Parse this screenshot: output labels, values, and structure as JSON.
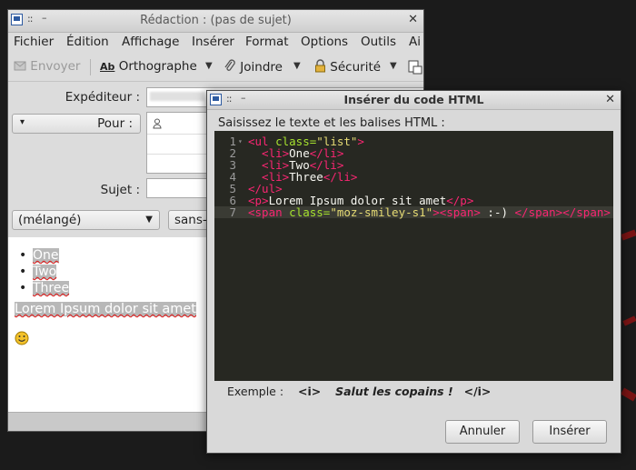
{
  "compose_window": {
    "title": "Rédaction : (pas de sujet)",
    "grip": "::",
    "minimize": "–",
    "close": "✕",
    "menu": [
      "Fichier",
      "Édition",
      "Affichage",
      "Insérer",
      "Format",
      "Options",
      "Outils",
      "Ai"
    ],
    "toolbar": {
      "send": "Envoyer",
      "spell_icon": "Ab",
      "spell": "Orthographe",
      "attach": "Joindre",
      "security": "Sécurité",
      "dropdown_arrow": "▼"
    },
    "headers": {
      "from_label": "Expéditeur :",
      "to_label": "Pour :",
      "to_dropdown_arrow": "▾",
      "subject_label": "Sujet :",
      "subject_value": ""
    },
    "format_bar": {
      "paragraph_style": "(mélangé)",
      "font": "sans-s",
      "arrow": "▼"
    },
    "body": {
      "list_items": [
        "One",
        "Two",
        "Three"
      ],
      "paragraph": "Lorem Ipsum dolor sit amet",
      "smiley": "☺"
    }
  },
  "dialog": {
    "title": "Insérer du code HTML",
    "grip": "::",
    "minimize": "–",
    "close": "✕",
    "instruction": "Saisissez le texte et les balises HTML :",
    "code_lines": [
      {
        "n": "1",
        "fold": "▾",
        "tokens": [
          {
            "t": "<ul ",
            "c": "tag"
          },
          {
            "t": "class=",
            "c": "attr"
          },
          {
            "t": "\"list\"",
            "c": "str"
          },
          {
            "t": ">",
            "c": "tag"
          }
        ]
      },
      {
        "n": "2",
        "fold": "",
        "tokens": [
          {
            "t": "  <li>",
            "c": "tag"
          },
          {
            "t": "One",
            "c": "text"
          },
          {
            "t": "</li>",
            "c": "tag"
          }
        ]
      },
      {
        "n": "3",
        "fold": "",
        "tokens": [
          {
            "t": "  <li>",
            "c": "tag"
          },
          {
            "t": "Two",
            "c": "text"
          },
          {
            "t": "</li>",
            "c": "tag"
          }
        ]
      },
      {
        "n": "4",
        "fold": "",
        "tokens": [
          {
            "t": "  <li>",
            "c": "tag"
          },
          {
            "t": "Three",
            "c": "text"
          },
          {
            "t": "</li>",
            "c": "tag"
          }
        ]
      },
      {
        "n": "5",
        "fold": "",
        "tokens": [
          {
            "t": "</ul>",
            "c": "tag"
          }
        ]
      },
      {
        "n": "6",
        "fold": "",
        "tokens": [
          {
            "t": "<p>",
            "c": "tag"
          },
          {
            "t": "Lorem Ipsum dolor sit amet",
            "c": "text"
          },
          {
            "t": "</p>",
            "c": "tag"
          }
        ]
      },
      {
        "n": "7",
        "fold": "",
        "tokens": [
          {
            "t": "<span ",
            "c": "tag"
          },
          {
            "t": "class=",
            "c": "attr"
          },
          {
            "t": "\"moz-smiley-s1\"",
            "c": "str"
          },
          {
            "t": "><span>",
            "c": "tag"
          },
          {
            "t": " :-) ",
            "c": "text"
          },
          {
            "t": "</span></span>",
            "c": "tag"
          }
        ]
      }
    ],
    "example_label": "Exemple :",
    "example_open": "<i>",
    "example_text": "Salut les copains !",
    "example_close": "</i>",
    "cancel": "Annuler",
    "insert": "Insérer"
  },
  "colors": {
    "editor_bg": "#272822",
    "tag": "#f92672",
    "attr": "#a6e22e",
    "string": "#e6db74",
    "text": "#f8f8f2"
  }
}
